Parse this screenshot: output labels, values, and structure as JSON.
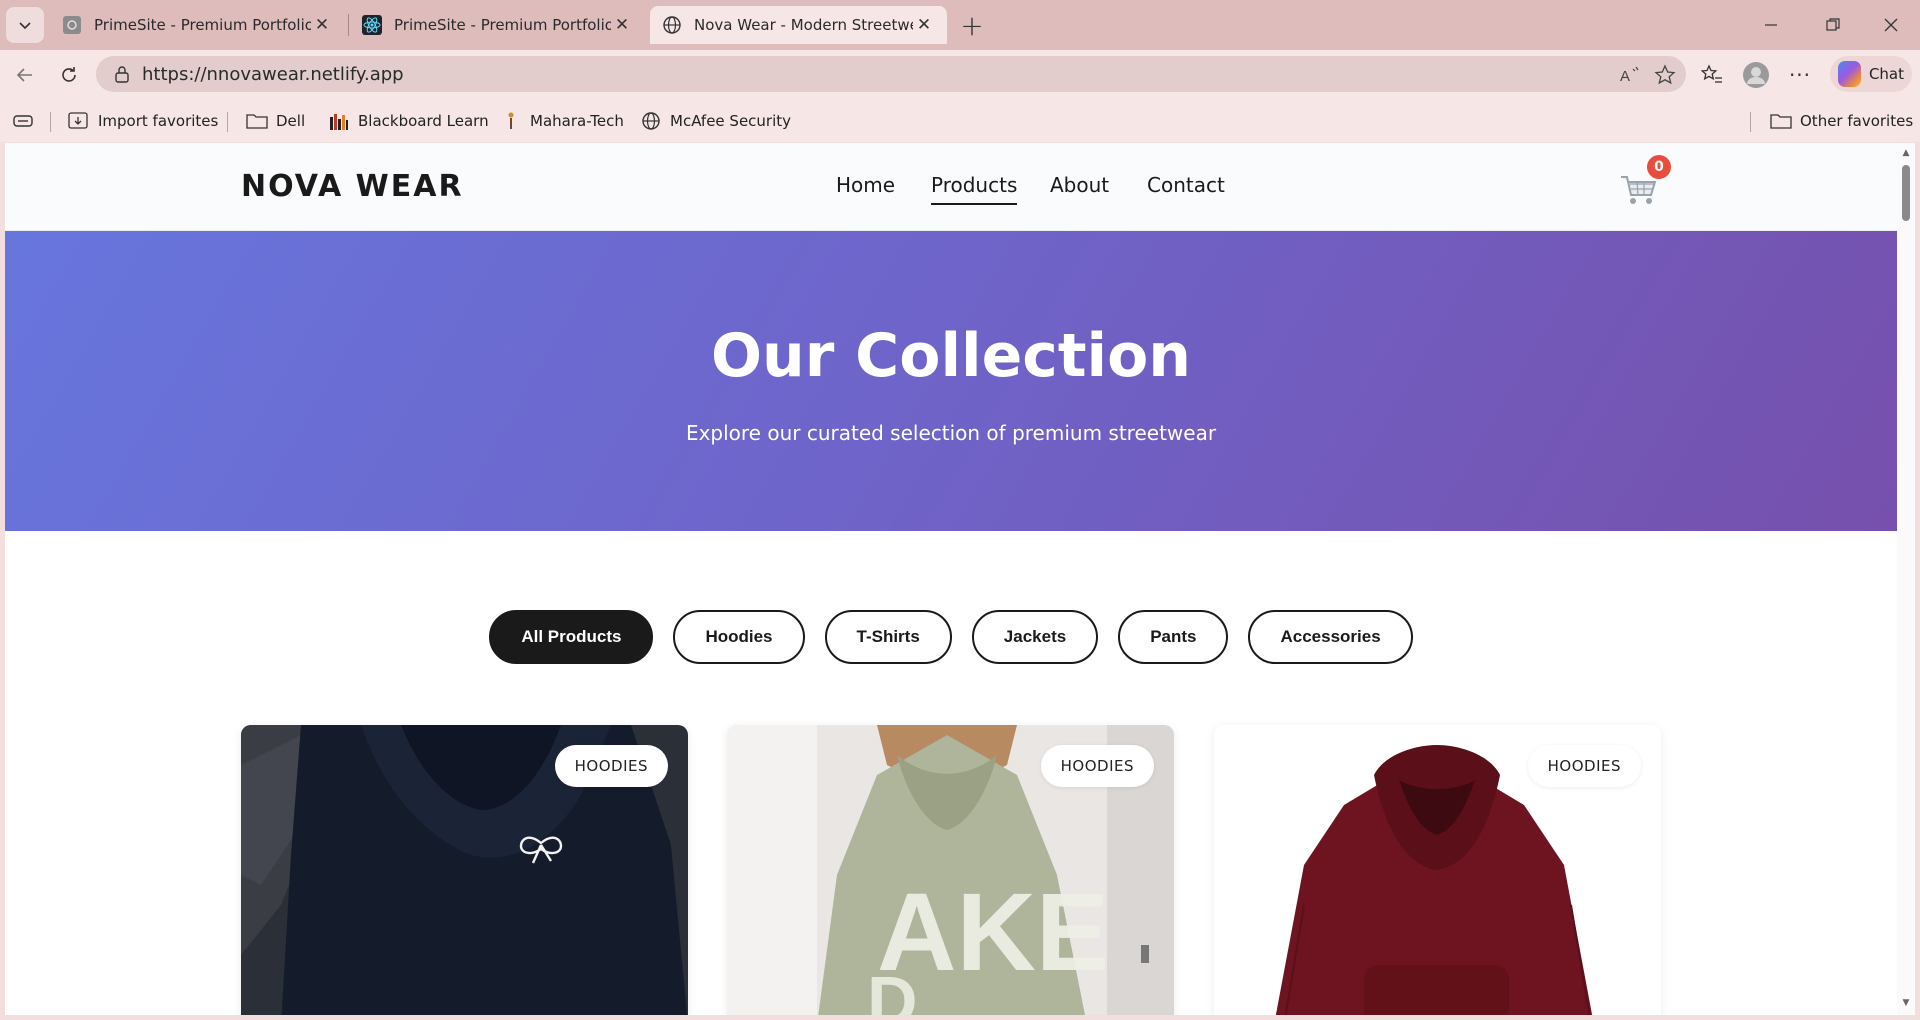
{
  "browser": {
    "tabs": [
      {
        "title": "PrimeSite - Premium Portfolio",
        "active": false
      },
      {
        "title": "PrimeSite - Premium Portfolio",
        "active": false
      },
      {
        "title": "Nova Wear - Modern Streetwear F",
        "active": true
      }
    ],
    "url": "https://nnovawear.netlify.app",
    "chat_label": "Chat",
    "bookmarks": [
      {
        "label": "Import favorites",
        "icon": "import-icon"
      },
      {
        "label": "Dell",
        "icon": "folder-icon"
      },
      {
        "label": "Blackboard Learn",
        "icon": "blackboard-icon"
      },
      {
        "label": "Mahara-Tech",
        "icon": "mahara-icon"
      },
      {
        "label": "McAfee Security",
        "icon": "globe-icon"
      }
    ],
    "other_favorites": "Other favorites"
  },
  "site": {
    "logo": "NOVA WEAR",
    "nav": [
      {
        "label": "Home",
        "active": false
      },
      {
        "label": "Products",
        "active": true
      },
      {
        "label": "About",
        "active": false
      },
      {
        "label": "Contact",
        "active": false
      }
    ],
    "cart_count": "0",
    "hero": {
      "title": "Our Collection",
      "subtitle": "Explore our curated selection of premium streetwear"
    },
    "filters": [
      {
        "label": "All Products",
        "active": true
      },
      {
        "label": "Hoodies",
        "active": false
      },
      {
        "label": "T-Shirts",
        "active": false
      },
      {
        "label": "Jackets",
        "active": false
      },
      {
        "label": "Pants",
        "active": false
      },
      {
        "label": "Accessories",
        "active": false
      }
    ],
    "products": [
      {
        "category": "HOODIES",
        "image": "navy-hoodie-with-bow"
      },
      {
        "category": "HOODIES",
        "image": "sage-green-hoodie-back-print"
      },
      {
        "category": "HOODIES",
        "image": "maroon-hoodie"
      }
    ]
  },
  "colors": {
    "tabbar": "#dfbcbc",
    "hero_start": "#6776dd",
    "hero_end": "#7650ac",
    "cart_badge": "#e74c3c"
  }
}
